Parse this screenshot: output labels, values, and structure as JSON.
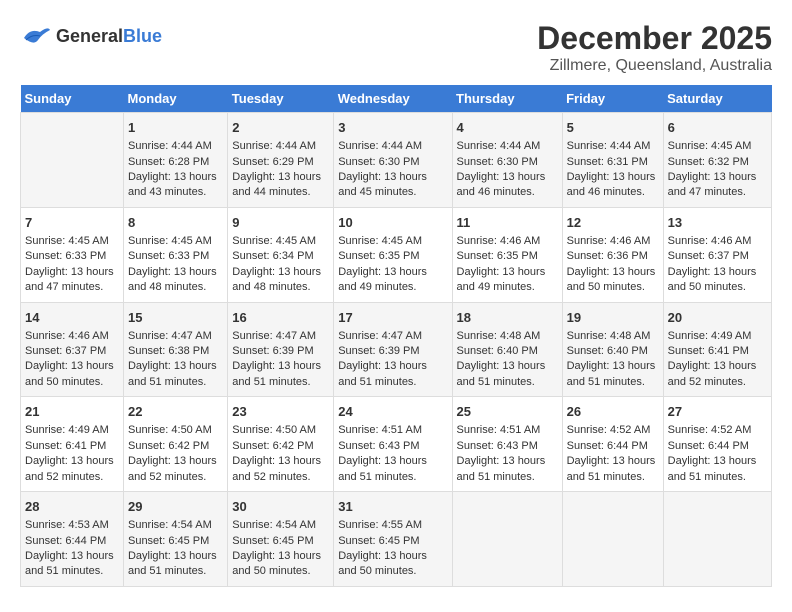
{
  "header": {
    "logo_general": "General",
    "logo_blue": "Blue",
    "title": "December 2025",
    "subtitle": "Zillmere, Queensland, Australia"
  },
  "days_of_week": [
    "Sunday",
    "Monday",
    "Tuesday",
    "Wednesday",
    "Thursday",
    "Friday",
    "Saturday"
  ],
  "weeks": [
    [
      {
        "day": "",
        "content": ""
      },
      {
        "day": "1",
        "sunrise": "Sunrise: 4:44 AM",
        "sunset": "Sunset: 6:28 PM",
        "daylight": "Daylight: 13 hours and 43 minutes."
      },
      {
        "day": "2",
        "sunrise": "Sunrise: 4:44 AM",
        "sunset": "Sunset: 6:29 PM",
        "daylight": "Daylight: 13 hours and 44 minutes."
      },
      {
        "day": "3",
        "sunrise": "Sunrise: 4:44 AM",
        "sunset": "Sunset: 6:30 PM",
        "daylight": "Daylight: 13 hours and 45 minutes."
      },
      {
        "day": "4",
        "sunrise": "Sunrise: 4:44 AM",
        "sunset": "Sunset: 6:30 PM",
        "daylight": "Daylight: 13 hours and 46 minutes."
      },
      {
        "day": "5",
        "sunrise": "Sunrise: 4:44 AM",
        "sunset": "Sunset: 6:31 PM",
        "daylight": "Daylight: 13 hours and 46 minutes."
      },
      {
        "day": "6",
        "sunrise": "Sunrise: 4:45 AM",
        "sunset": "Sunset: 6:32 PM",
        "daylight": "Daylight: 13 hours and 47 minutes."
      }
    ],
    [
      {
        "day": "7",
        "sunrise": "Sunrise: 4:45 AM",
        "sunset": "Sunset: 6:33 PM",
        "daylight": "Daylight: 13 hours and 47 minutes."
      },
      {
        "day": "8",
        "sunrise": "Sunrise: 4:45 AM",
        "sunset": "Sunset: 6:33 PM",
        "daylight": "Daylight: 13 hours and 48 minutes."
      },
      {
        "day": "9",
        "sunrise": "Sunrise: 4:45 AM",
        "sunset": "Sunset: 6:34 PM",
        "daylight": "Daylight: 13 hours and 48 minutes."
      },
      {
        "day": "10",
        "sunrise": "Sunrise: 4:45 AM",
        "sunset": "Sunset: 6:35 PM",
        "daylight": "Daylight: 13 hours and 49 minutes."
      },
      {
        "day": "11",
        "sunrise": "Sunrise: 4:46 AM",
        "sunset": "Sunset: 6:35 PM",
        "daylight": "Daylight: 13 hours and 49 minutes."
      },
      {
        "day": "12",
        "sunrise": "Sunrise: 4:46 AM",
        "sunset": "Sunset: 6:36 PM",
        "daylight": "Daylight: 13 hours and 50 minutes."
      },
      {
        "day": "13",
        "sunrise": "Sunrise: 4:46 AM",
        "sunset": "Sunset: 6:37 PM",
        "daylight": "Daylight: 13 hours and 50 minutes."
      }
    ],
    [
      {
        "day": "14",
        "sunrise": "Sunrise: 4:46 AM",
        "sunset": "Sunset: 6:37 PM",
        "daylight": "Daylight: 13 hours and 50 minutes."
      },
      {
        "day": "15",
        "sunrise": "Sunrise: 4:47 AM",
        "sunset": "Sunset: 6:38 PM",
        "daylight": "Daylight: 13 hours and 51 minutes."
      },
      {
        "day": "16",
        "sunrise": "Sunrise: 4:47 AM",
        "sunset": "Sunset: 6:39 PM",
        "daylight": "Daylight: 13 hours and 51 minutes."
      },
      {
        "day": "17",
        "sunrise": "Sunrise: 4:47 AM",
        "sunset": "Sunset: 6:39 PM",
        "daylight": "Daylight: 13 hours and 51 minutes."
      },
      {
        "day": "18",
        "sunrise": "Sunrise: 4:48 AM",
        "sunset": "Sunset: 6:40 PM",
        "daylight": "Daylight: 13 hours and 51 minutes."
      },
      {
        "day": "19",
        "sunrise": "Sunrise: 4:48 AM",
        "sunset": "Sunset: 6:40 PM",
        "daylight": "Daylight: 13 hours and 51 minutes."
      },
      {
        "day": "20",
        "sunrise": "Sunrise: 4:49 AM",
        "sunset": "Sunset: 6:41 PM",
        "daylight": "Daylight: 13 hours and 52 minutes."
      }
    ],
    [
      {
        "day": "21",
        "sunrise": "Sunrise: 4:49 AM",
        "sunset": "Sunset: 6:41 PM",
        "daylight": "Daylight: 13 hours and 52 minutes."
      },
      {
        "day": "22",
        "sunrise": "Sunrise: 4:50 AM",
        "sunset": "Sunset: 6:42 PM",
        "daylight": "Daylight: 13 hours and 52 minutes."
      },
      {
        "day": "23",
        "sunrise": "Sunrise: 4:50 AM",
        "sunset": "Sunset: 6:42 PM",
        "daylight": "Daylight: 13 hours and 52 minutes."
      },
      {
        "day": "24",
        "sunrise": "Sunrise: 4:51 AM",
        "sunset": "Sunset: 6:43 PM",
        "daylight": "Daylight: 13 hours and 51 minutes."
      },
      {
        "day": "25",
        "sunrise": "Sunrise: 4:51 AM",
        "sunset": "Sunset: 6:43 PM",
        "daylight": "Daylight: 13 hours and 51 minutes."
      },
      {
        "day": "26",
        "sunrise": "Sunrise: 4:52 AM",
        "sunset": "Sunset: 6:44 PM",
        "daylight": "Daylight: 13 hours and 51 minutes."
      },
      {
        "day": "27",
        "sunrise": "Sunrise: 4:52 AM",
        "sunset": "Sunset: 6:44 PM",
        "daylight": "Daylight: 13 hours and 51 minutes."
      }
    ],
    [
      {
        "day": "28",
        "sunrise": "Sunrise: 4:53 AM",
        "sunset": "Sunset: 6:44 PM",
        "daylight": "Daylight: 13 hours and 51 minutes."
      },
      {
        "day": "29",
        "sunrise": "Sunrise: 4:54 AM",
        "sunset": "Sunset: 6:45 PM",
        "daylight": "Daylight: 13 hours and 51 minutes."
      },
      {
        "day": "30",
        "sunrise": "Sunrise: 4:54 AM",
        "sunset": "Sunset: 6:45 PM",
        "daylight": "Daylight: 13 hours and 50 minutes."
      },
      {
        "day": "31",
        "sunrise": "Sunrise: 4:55 AM",
        "sunset": "Sunset: 6:45 PM",
        "daylight": "Daylight: 13 hours and 50 minutes."
      },
      {
        "day": "",
        "content": ""
      },
      {
        "day": "",
        "content": ""
      },
      {
        "day": "",
        "content": ""
      }
    ]
  ]
}
